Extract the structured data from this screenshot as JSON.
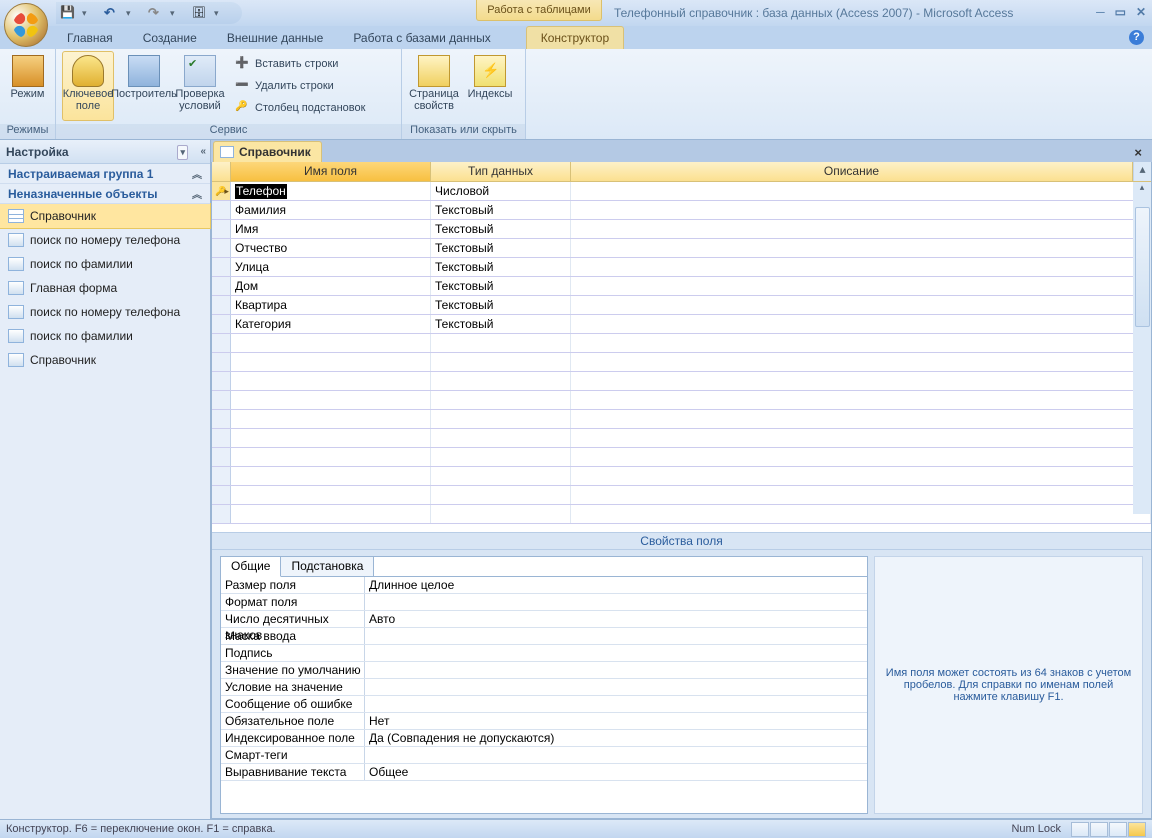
{
  "title": "Телефонный справочник : база данных (Access 2007) - Microsoft Access",
  "tableTools": "Работа с таблицами",
  "ribbonTabs": {
    "home": "Главная",
    "create": "Создание",
    "external": "Внешние данные",
    "dbtools": "Работа с базами данных",
    "design": "Конструктор"
  },
  "ribbon": {
    "groupModes": "Режимы",
    "groupService": "Сервис",
    "groupShowHide": "Показать или скрыть",
    "mode": "Режим",
    "keyField": "Ключевое поле",
    "builder": "Построитель",
    "validate": "Проверка условий",
    "insertRows": "Вставить строки",
    "deleteRows": "Удалить строки",
    "lookupCol": "Столбец подстановок",
    "propSheet": "Страница свойств",
    "indexes": "Индексы"
  },
  "nav": {
    "header": "Настройка",
    "group1": "Настраиваемая группа 1",
    "group2": "Неназначенные объекты",
    "items": [
      {
        "label": "Справочник",
        "sel": true,
        "type": "table"
      },
      {
        "label": "поиск по номеру телефона",
        "type": "form"
      },
      {
        "label": "поиск по фамилии",
        "type": "form"
      },
      {
        "label": "Главная форма",
        "type": "form"
      },
      {
        "label": "поиск по номеру телефона",
        "type": "form"
      },
      {
        "label": "поиск по фамилии",
        "type": "form"
      },
      {
        "label": "Справочник",
        "type": "form"
      }
    ]
  },
  "docTab": "Справочник",
  "gridHeaders": {
    "name": "Имя поля",
    "type": "Тип данных",
    "desc": "Описание"
  },
  "fields": [
    {
      "name": "Телефон",
      "type": "Числовой",
      "pk": true,
      "active": true
    },
    {
      "name": "Фамилия",
      "type": "Текстовый"
    },
    {
      "name": "Имя",
      "type": "Текстовый"
    },
    {
      "name": "Отчество",
      "type": "Текстовый"
    },
    {
      "name": "Улица",
      "type": "Текстовый"
    },
    {
      "name": "Дом",
      "type": "Текстовый"
    },
    {
      "name": "Квартира",
      "type": "Текстовый"
    },
    {
      "name": "Категория",
      "type": "Текстовый"
    }
  ],
  "propsHeader": "Свойства поля",
  "propTabs": {
    "general": "Общие",
    "lookup": "Подстановка"
  },
  "props": [
    {
      "label": "Размер поля",
      "value": "Длинное целое"
    },
    {
      "label": "Формат поля",
      "value": ""
    },
    {
      "label": "Число десятичных знаков",
      "value": "Авто"
    },
    {
      "label": "Маска ввода",
      "value": ""
    },
    {
      "label": "Подпись",
      "value": ""
    },
    {
      "label": "Значение по умолчанию",
      "value": ""
    },
    {
      "label": "Условие на значение",
      "value": ""
    },
    {
      "label": "Сообщение об ошибке",
      "value": ""
    },
    {
      "label": "Обязательное поле",
      "value": "Нет"
    },
    {
      "label": "Индексированное поле",
      "value": "Да (Совпадения не допускаются)"
    },
    {
      "label": "Смарт-теги",
      "value": ""
    },
    {
      "label": "Выравнивание текста",
      "value": "Общее"
    }
  ],
  "hint": "Имя поля может состоять из 64 знаков с учетом пробелов.  Для справки по именам полей нажмите клавишу F1.",
  "status": {
    "left": "Конструктор.  F6 = переключение окон.  F1 = справка.",
    "numlock": "Num Lock"
  }
}
